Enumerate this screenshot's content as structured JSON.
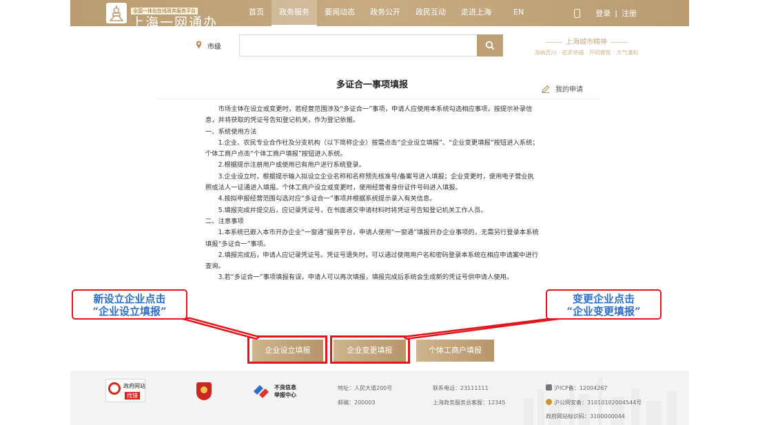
{
  "header": {
    "logo_subtitle": "全国一体化在线政务服务平台",
    "logo_title": "上海一网通办",
    "nav": [
      {
        "label": "首页",
        "active": false
      },
      {
        "label": "政务服务",
        "active": true
      },
      {
        "label": "要闻动态",
        "active": false
      },
      {
        "label": "政务公开",
        "active": false
      },
      {
        "label": "政民互动",
        "active": false
      },
      {
        "label": "走进上海",
        "active": false
      }
    ],
    "lang": "EN",
    "login": "登录",
    "divider": "|",
    "register": "注册",
    "accent_color": "#bf9f75"
  },
  "search": {
    "location": "市级",
    "placeholder": "",
    "value": ""
  },
  "slogan": {
    "title": "上海城市精神",
    "subtitle": "海纳百川 · 追求卓越 · 开明睿智 · 大气谦和"
  },
  "content": {
    "title": "多证合一事项填报",
    "my_application": "我的申请",
    "paragraphs": [
      {
        "text": "市场主体在设立或变更时，若经营范围涉及“多证合一”事项，申请人应使用本系统勾选相应事项，按提示补录信息，并将获取的凭证号告知登记机关，作为登记依据。",
        "indent": true
      },
      {
        "text": "一、系统使用方法",
        "indent": false
      },
      {
        "text": "1.企业、农民专业合作社及分支机构（以下简称企业）按需点击“企业设立填报”、“企业变更填报”按钮进入系统；个体工商户点击“个体工商户填报”按钮进入系统。",
        "indent": true
      },
      {
        "text": "2.根据提示注册用户或使用已有用户进行系统登录。",
        "indent": true
      },
      {
        "text": "3.企业设立时，根据提示输入拟设立企业名称和名称预先核准号/备案号进入填报；企业变更时，使用电子营业执照或法人一证通进入填报。个体工商户设立或变更时，使用经营者身份证件号码进入填报。",
        "indent": true
      },
      {
        "text": "4.按拟申报经营范围勾选对应“多证合一”事项并根据系统提示录入有关信息。",
        "indent": true
      },
      {
        "text": "5.填报完成并提交后，应记录凭证号，在书面递交申请材料时将凭证号告知登记机关工作人员。",
        "indent": true
      },
      {
        "text": "二、注意事项",
        "indent": false
      },
      {
        "text": "1.本系统已嵌入本市开办企业“一窗通”服务平台，申请人使用“一窗通”填报开办企业事项的，无需另行登录本系统填报“多证合一”事项。",
        "indent": true
      },
      {
        "text": "2.填报完成后，申请人应记录凭证号。凭证号遗失时，可以通过使用用户名和密码登录本系统在相应申请案中进行查询。",
        "indent": true
      },
      {
        "text": "3.若“多证合一”事项填报有误，申请人可以再次填报，填报完成后系统会生成新的凭证号供申请人使用。",
        "indent": true
      }
    ]
  },
  "buttons": {
    "enterprise_setup": "企业设立填报",
    "enterprise_change": "企业变更填报",
    "individual": "个体工商户填报"
  },
  "annotations": {
    "left": {
      "line1": "新设立企业点击",
      "line2": "“企业设立填报”"
    },
    "right": {
      "line1": "变更企业点击",
      "line2": "“企业变更填报”"
    },
    "highlight_color": "#e2151d",
    "text_color": "#2e6fc7"
  },
  "footer": {
    "gov_site_title": "政府网站",
    "gov_site_sub": "找错",
    "report_center_line1": "不良信息",
    "report_center_line2": "举报中心",
    "address": "地址：人民大道200号",
    "postcode": "邮编：200003",
    "phone": "联系电话：23111111",
    "service_hotline": "上海政务服务总客服：12345",
    "icp": "沪ICP备：12004267",
    "police": "沪公网安备：31010102004544号",
    "site_id": "政府网站标识码：3100000044"
  }
}
